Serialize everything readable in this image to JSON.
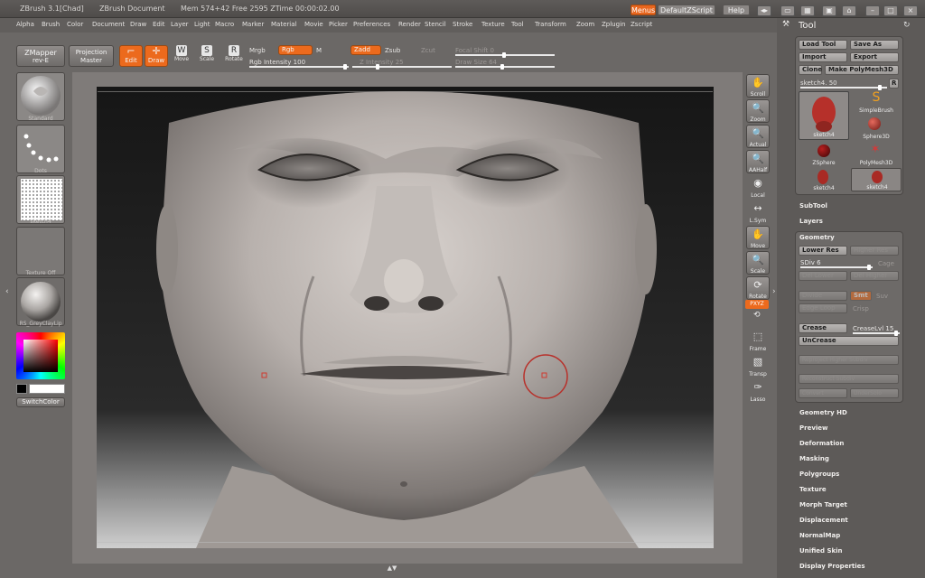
{
  "titlebar": {
    "app": "ZBrush  3.1[Chad]",
    "document": "ZBrush Document",
    "mem": "Mem 574+42 Free 2595 ZTime 00:00:02.00",
    "menus_btn": "Menus",
    "script_btn": "DefaultZScript",
    "help_btn": "Help"
  },
  "menubar": [
    "Alpha",
    "Brush",
    "Color",
    "Document",
    "Draw",
    "Edit",
    "Layer",
    "Light",
    "Macro",
    "Marker",
    "Material",
    "Movie",
    "Picker",
    "Preferences",
    "Render",
    "Stencil",
    "Stroke",
    "Texture",
    "Tool",
    "Transform",
    "Zoom",
    "Zplugin",
    "Zscript"
  ],
  "shelf": {
    "zmapper": "ZMapper",
    "zmapper_sub": "rev-E",
    "projection": "Projection",
    "projection_sub": "Master",
    "edit": "Edit",
    "draw": "Draw",
    "move": "Move",
    "scale": "Scale",
    "rotate": "Rotate",
    "mrgb": "Mrgb",
    "rgb": "Rgb",
    "m": "M",
    "rgb_intensity": "Rgb Intensity 100",
    "zadd": "Zadd",
    "zsub": "Zsub",
    "zcut": "Zcut",
    "z_intensity": "Z Intensity 25",
    "focal_shift": "Focal Shift 0",
    "draw_size": "Draw Size 64"
  },
  "left": {
    "standard": "Standard",
    "dots": "Dots",
    "sketch4": "sketch4",
    "texture_off": "Texture Off",
    "material": "RS_GreyClayLip",
    "switch_color": "SwitchColor"
  },
  "right_strip": [
    "Scroll",
    "Zoom",
    "Actual",
    "AAHalf",
    "Local",
    "L.Sym",
    "Move",
    "Scale",
    "Rotate",
    "PXYZ",
    "Frame",
    "Transp",
    "Lasso"
  ],
  "tool": {
    "title": "Tool",
    "load": "Load Tool",
    "save": "Save As",
    "import": "Import",
    "export": "Export",
    "clone": "Clone",
    "make_polymesh": "Make PolyMesh3D",
    "current": "sketch4. 50",
    "r": "R",
    "thumbs": [
      "sketch4",
      "SimpleBrush",
      "Sphere3D",
      "ZSphere",
      "PolyMesh3D",
      "sketch4",
      "sketch4"
    ],
    "subtool": "SubTool",
    "layers": "Layers",
    "geometry": "Geometry",
    "lower_res": "Lower Res",
    "higher_res": "Higher Res",
    "sdiv": "SDiv 6",
    "cage": "Cage",
    "del_lower": "Del Lower",
    "del_higher": "Del Higher",
    "divide": "Divide",
    "smt": "Smt",
    "suv": "Suv",
    "edge_loop": "Edge Loop",
    "crisp": "Crisp",
    "crease": "Crease",
    "crease_lvl": "CreaseLvl 15",
    "uncrease": "UnCrease",
    "reproject": "Reproject Higher Subdiv",
    "reconstruct": "Reconstruct Subdiv",
    "convert1": "Convert",
    "convert2": "UnderSolo",
    "sections": [
      "Geometry HD",
      "Preview",
      "Deformation",
      "Masking",
      "Polygroups",
      "Texture",
      "Morph Target",
      "Displacement",
      "NormalMap",
      "Unified Skin",
      "Display Properties"
    ]
  },
  "colors": {
    "accent": "#ec6a1d",
    "panel": "#5d5a58",
    "bg": "#6b6866"
  }
}
